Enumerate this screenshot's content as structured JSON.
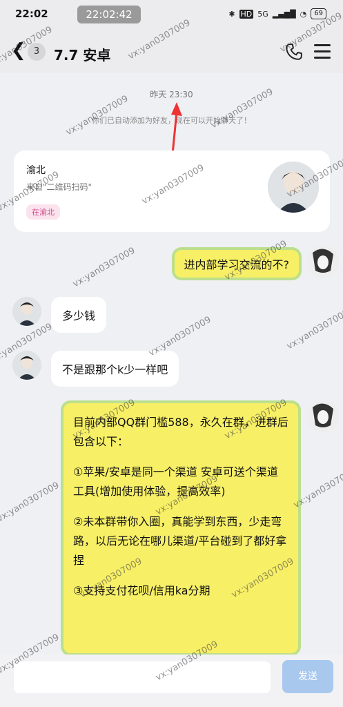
{
  "status_bar": {
    "time": "22:02",
    "recording_time": "22:02:42",
    "network": "5G",
    "battery": "69"
  },
  "header": {
    "back_count": "3",
    "title": "7.7 安卓"
  },
  "system": {
    "time": "昨天 23:30",
    "note": "你们已自动添加为好友，现在可以开始聊天了！"
  },
  "friend_card": {
    "name": "渝北",
    "source": "来自\"二维码扫码\"",
    "tag": "在渝北"
  },
  "messages": [
    {
      "side": "right",
      "text": "进内部学习交流的不?"
    },
    {
      "side": "left",
      "text": "多少钱"
    },
    {
      "side": "left",
      "text": "不是跟那个k少一样吧"
    },
    {
      "side": "right",
      "paragraphs": [
        "目前内部QQ群门槛588，永久在群，进群后包含以下：",
        "①苹果/安卓是同一个渠道 安卓可送个渠道工具(增加使用体验，提高效率)",
        "②未本群带你入圈，真能学到东西，少走弯路，以后无论在哪儿渠道/平台碰到了都好拿捏",
        "③支持支付花呗/信用ka分期"
      ]
    }
  ],
  "input": {
    "send_label": "发送"
  },
  "watermark": "vx:yan0307009",
  "colors": {
    "bubble_yellow": "#f7ef66",
    "bubble_border": "#bcdf8d",
    "send_button": "#a8c8ee",
    "tag_pink": "#d04888"
  }
}
